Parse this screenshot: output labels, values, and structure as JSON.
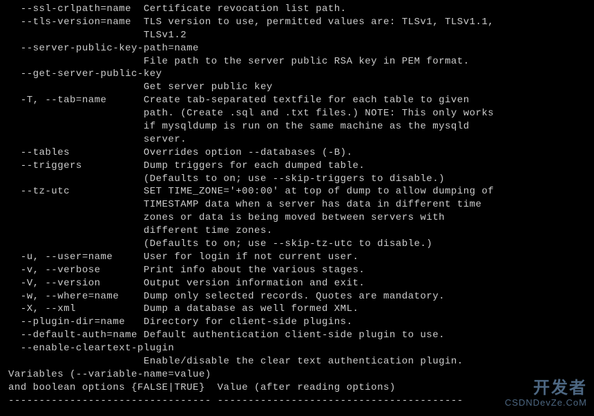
{
  "lines": {
    "l0": "  --ssl-crlpath=name  Certificate revocation list path.",
    "l1": "  --tls-version=name  TLS version to use, permitted values are: TLSv1, TLSv1.1,",
    "l2": "                      TLSv1.2",
    "l3": "  --server-public-key-path=name",
    "l4": "                      File path to the server public RSA key in PEM format.",
    "l5": "  --get-server-public-key",
    "l6": "                      Get server public key",
    "l7": "  -T, --tab=name      Create tab-separated textfile for each table to given",
    "l8": "                      path. (Create .sql and .txt files.) NOTE: This only works",
    "l9": "                      if mysqldump is run on the same machine as the mysqld",
    "l10": "                      server.",
    "l11": "  --tables            Overrides option --databases (-B).",
    "l12": "  --triggers          Dump triggers for each dumped table.",
    "l13": "                      (Defaults to on; use --skip-triggers to disable.)",
    "l14": "  --tz-utc            SET TIME_ZONE='+00:00' at top of dump to allow dumping of",
    "l15": "                      TIMESTAMP data when a server has data in different time",
    "l16": "                      zones or data is being moved between servers with",
    "l17": "                      different time zones.",
    "l18": "                      (Defaults to on; use --skip-tz-utc to disable.)",
    "l19": "  -u, --user=name     User for login if not current user.",
    "l20": "  -v, --verbose       Print info about the various stages.",
    "l21": "  -V, --version       Output version information and exit.",
    "l22": "  -w, --where=name    Dump only selected records. Quotes are mandatory.",
    "l23": "  -X, --xml           Dump a database as well formed XML.",
    "l24": "  --plugin-dir=name   Directory for client-side plugins.",
    "l25": "  --default-auth=name Default authentication client-side plugin to use.",
    "l26": "  --enable-cleartext-plugin",
    "l27": "                      Enable/disable the clear text authentication plugin.",
    "l28": "",
    "l29": "Variables (--variable-name=value)",
    "l30": "and boolean options {FALSE|TRUE}  Value (after reading options)",
    "l31": "--------------------------------- ----------------------------------------"
  },
  "watermark": {
    "top": "开发者",
    "bottom": "CSDNDevZe.CoM"
  }
}
